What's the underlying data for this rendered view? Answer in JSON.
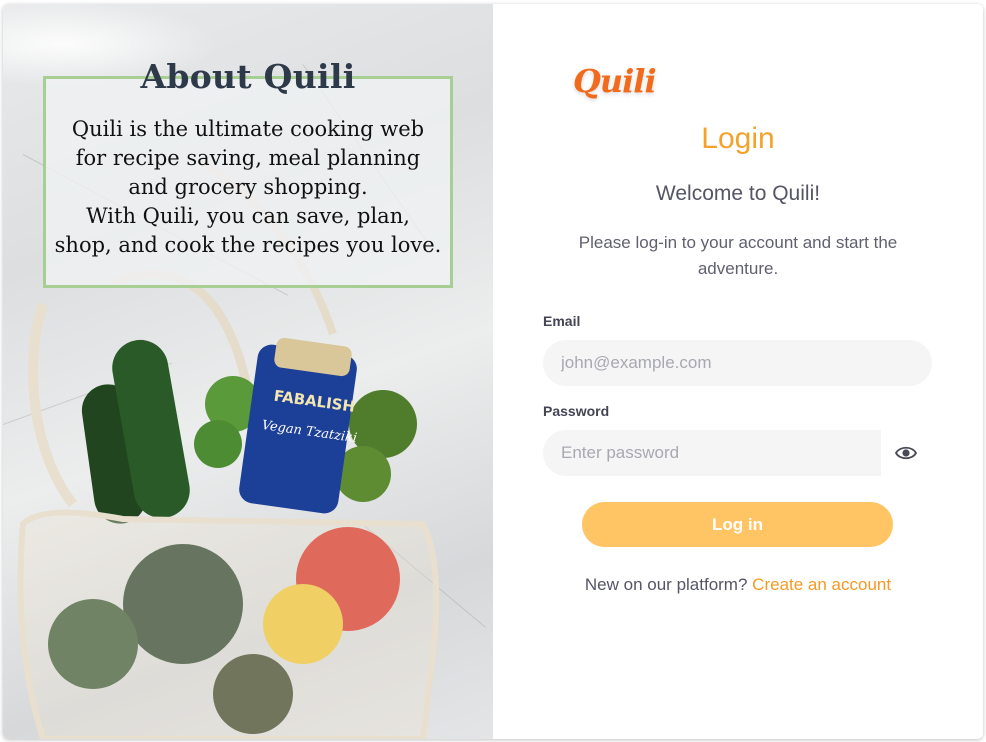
{
  "about": {
    "title": "About Quili",
    "text_lines": [
      "Quili is the ultimate cooking web",
      "for recipe saving, meal planning",
      "and grocery shopping.",
      "With Quili, you can save, plan,",
      "shop, and cook the recipes you love."
    ]
  },
  "photo": {
    "jar_brand": "FABALISH",
    "jar_product": "Vegan Tzatziki"
  },
  "logo": {
    "text": "Quili"
  },
  "login": {
    "title": "Login",
    "welcome": "Welcome to Quili!",
    "subtitle": "Please log-in to your account and start the adventure.",
    "email_label": "Email",
    "email_placeholder": "john@example.com",
    "email_value": "",
    "password_label": "Password",
    "password_placeholder": "Enter password",
    "password_value": "",
    "password_toggle_icon": "eye-icon",
    "submit_label": "Log in",
    "signup_prompt": "New on our platform?",
    "signup_link": "Create an account"
  },
  "colors": {
    "accent": "#f5a22a",
    "button": "#ffc565",
    "link": "#f59a23",
    "about_border": "#a8cf93"
  }
}
